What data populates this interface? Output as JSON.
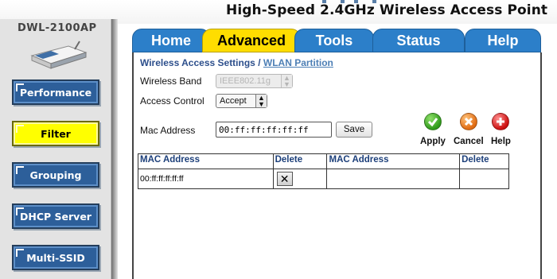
{
  "header": {
    "title": "High-Speed 2.4GHz Wireless Access Point"
  },
  "sidebar": {
    "model": "DWL-2100AP",
    "items": [
      {
        "label": "Performance",
        "active": false
      },
      {
        "label": "Filter",
        "active": true
      },
      {
        "label": "Grouping",
        "active": false
      },
      {
        "label": "DHCP Server",
        "active": false
      },
      {
        "label": "Multi-SSID",
        "active": false
      }
    ]
  },
  "tabs": [
    {
      "label": "Home",
      "active": false
    },
    {
      "label": "Advanced",
      "active": true
    },
    {
      "label": "Tools",
      "active": false
    },
    {
      "label": "Status",
      "active": false
    },
    {
      "label": "Help",
      "active": false
    }
  ],
  "breadcrumb": {
    "current": "Wireless Access Settings",
    "separator": "/",
    "link": "WLAN Partition"
  },
  "form": {
    "wireless_band_label": "Wireless Band",
    "wireless_band_value": "IEEE802.11g",
    "access_control_label": "Access Control",
    "access_control_value": "Accept",
    "mac_address_label": "Mac Address",
    "mac_address_value": "00:ff:ff:ff:ff:ff",
    "save_label": "Save"
  },
  "actions": {
    "apply": "Apply",
    "cancel": "Cancel",
    "help": "Help"
  },
  "table": {
    "headers": [
      "MAC Address",
      "Delete",
      "MAC Address",
      "Delete"
    ],
    "rows": [
      {
        "mac": "00:ff:ff:ff:ff:ff",
        "delete": "✕",
        "mac2": "",
        "delete2": ""
      }
    ]
  },
  "colors": {
    "nav_blue": "#2d5f9a",
    "active_yellow": "#ffff00",
    "tab_blue": "#2c7fc9",
    "tab_active": "#ffdd00",
    "header_text": "#1c3f7a"
  }
}
